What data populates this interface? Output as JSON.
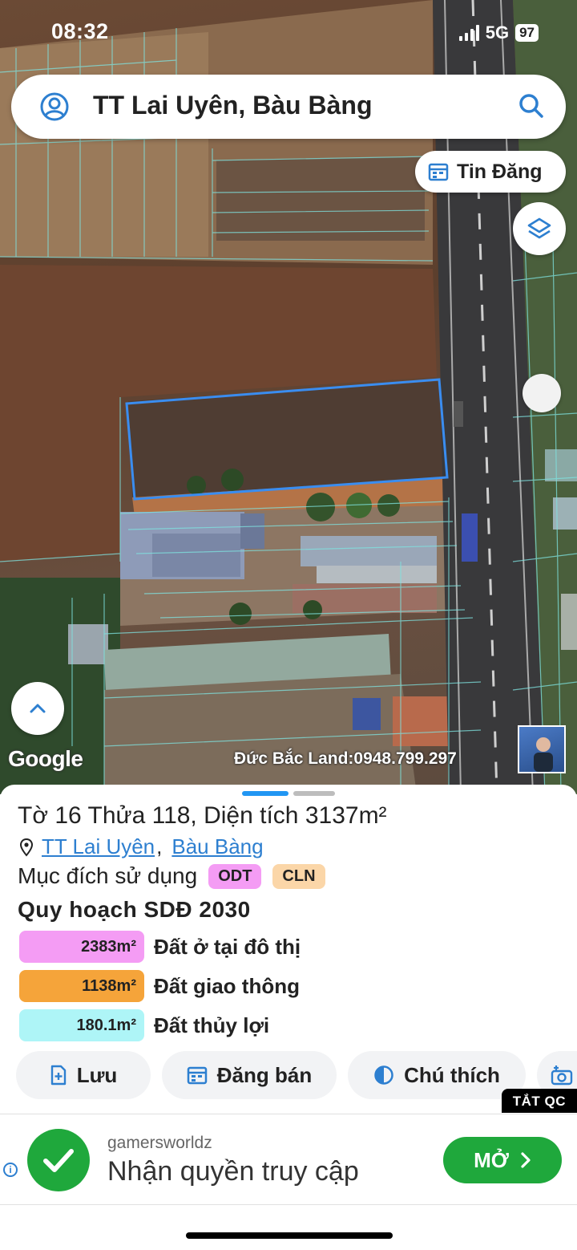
{
  "status": {
    "time": "08:32",
    "network": "5G",
    "battery": "97"
  },
  "search": {
    "place": "TT Lai Uyên, Bàu Bàng"
  },
  "map": {
    "tin_dang_label": "Tin Đăng",
    "attribution": "Google",
    "watermark": "Đức Bắc Land:0948.799.297"
  },
  "parcel": {
    "title": "Tờ 16 Thửa 118, Diện tích 3137m²",
    "address_ward": "TT Lai Uyên",
    "address_separator": ",",
    "address_district": "Bàu Bàng",
    "purpose_label": "Mục đích sử dụng",
    "purpose_codes": [
      "ODT",
      "CLN"
    ],
    "plan_title": "Quy hoạch SDĐ 2030",
    "zones": [
      {
        "area": "2383m²",
        "name": "Đất ở tại đô thị",
        "color": "#f49cf4"
      },
      {
        "area": "1138m²",
        "name": "Đất giao thông",
        "color": "#f5a43a"
      },
      {
        "area": "180.1m²",
        "name": "Đất thủy lợi",
        "color": "#aef5f7"
      }
    ]
  },
  "actions": {
    "save": "Lưu",
    "post_sale": "Đăng bán",
    "legend": "Chú thích"
  },
  "ad": {
    "close_label": "TẮT QC",
    "brand": "gamersworldz",
    "headline": "Nhận quyền truy cập",
    "open_label": "MỞ",
    "accent": "#1fa83c"
  },
  "colors": {
    "link": "#2d7fd0",
    "parcel_outline": "#3a8df0"
  }
}
